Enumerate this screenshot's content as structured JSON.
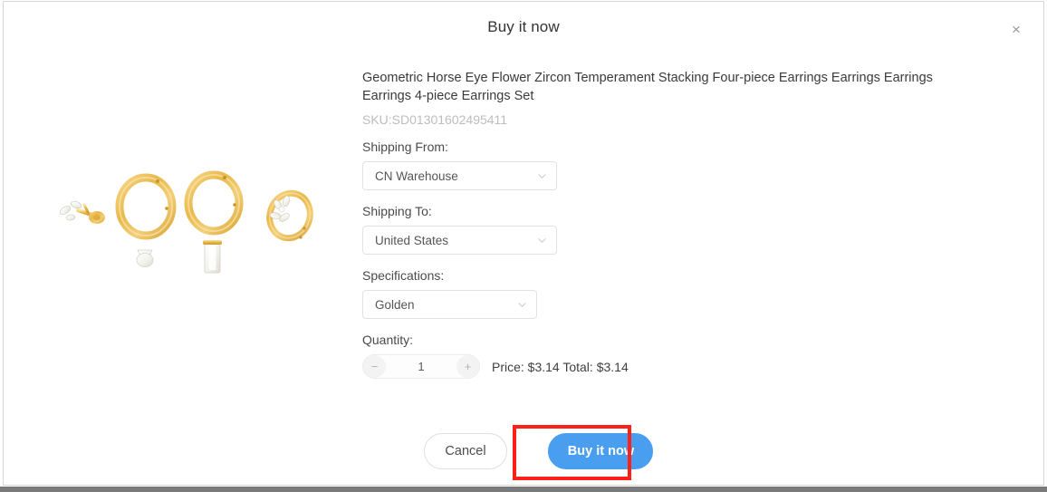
{
  "modal": {
    "title": "Buy it now",
    "close_icon": "close-icon",
    "close_label": "×"
  },
  "product": {
    "title": "Geometric Horse Eye Flower Zircon Temperament Stacking Four-piece Earrings Earrings Earrings Earrings 4-piece Earrings Set",
    "sku": "SKU:SD01301602495411",
    "image_alt": "four-gold-earrings"
  },
  "form": {
    "shipping_from": {
      "label": "Shipping From:",
      "value": "CN Warehouse"
    },
    "shipping_to": {
      "label": "Shipping To:",
      "value": "United States"
    },
    "specifications": {
      "label": "Specifications:",
      "value": "Golden"
    },
    "quantity": {
      "label": "Quantity:",
      "value": "1",
      "decrement": "−",
      "increment": "+"
    },
    "price_summary": "Price: $3.14 Total: $3.14"
  },
  "footer": {
    "cancel_label": "Cancel",
    "buy_label": "Buy it now"
  },
  "colors": {
    "accent_blue": "#4a9ef0",
    "highlight_red": "#ff2018",
    "sku_gray": "#bdbdbd",
    "border_gray": "#e2e2e2"
  }
}
